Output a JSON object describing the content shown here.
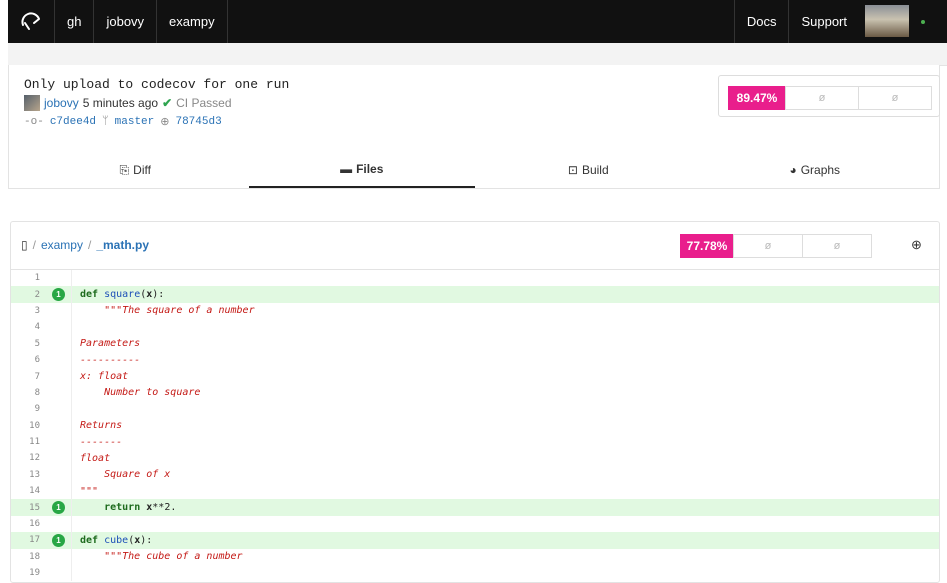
{
  "nav": {
    "items": [
      "gh",
      "jobovy",
      "exampy"
    ],
    "right": [
      "Docs",
      "Support"
    ]
  },
  "commit": {
    "title": "Only upload to codecov for one run",
    "author": "jobovy",
    "time": "5 minutes ago",
    "ci_status": "CI Passed",
    "commit_sha": "c7dee4d",
    "branch": "master",
    "parent_sha": "78745d3",
    "coverage": {
      "percent": "89.47%",
      "patch": "ø",
      "change": "ø"
    }
  },
  "tabs": [
    "Diff",
    "Files",
    "Build",
    "Graphs"
  ],
  "file": {
    "repo": "exampy",
    "filename": "_math.py",
    "coverage": {
      "percent": "77.78%",
      "patch": "ø",
      "change": "ø"
    }
  },
  "code_lines": [
    {
      "n": "1",
      "hits": "",
      "text": ""
    },
    {
      "n": "2",
      "hits": "1",
      "text": "def square(x):"
    },
    {
      "n": "3",
      "hits": "",
      "text": "    \"\"\"The square of a number"
    },
    {
      "n": "4",
      "hits": "",
      "text": ""
    },
    {
      "n": "5",
      "hits": "",
      "text": "Parameters"
    },
    {
      "n": "6",
      "hits": "",
      "text": "----------"
    },
    {
      "n": "7",
      "hits": "",
      "text": "x: float"
    },
    {
      "n": "8",
      "hits": "",
      "text": "    Number to square"
    },
    {
      "n": "9",
      "hits": "",
      "text": ""
    },
    {
      "n": "10",
      "hits": "",
      "text": "Returns"
    },
    {
      "n": "11",
      "hits": "",
      "text": "-------"
    },
    {
      "n": "12",
      "hits": "",
      "text": "float"
    },
    {
      "n": "13",
      "hits": "",
      "text": "    Square of x"
    },
    {
      "n": "14",
      "hits": "",
      "text": "\"\"\""
    },
    {
      "n": "15",
      "hits": "1",
      "text": "    return x**2."
    },
    {
      "n": "16",
      "hits": "",
      "text": ""
    },
    {
      "n": "17",
      "hits": "1",
      "text": "def cube(x):"
    },
    {
      "n": "18",
      "hits": "",
      "text": "    \"\"\"The cube of a number"
    },
    {
      "n": "19",
      "hits": "",
      "text": ""
    }
  ],
  "colors": {
    "coverage_accent": "#e91e8c",
    "hit_row": "#e1f9e1",
    "hit_badge": "#28a745"
  }
}
